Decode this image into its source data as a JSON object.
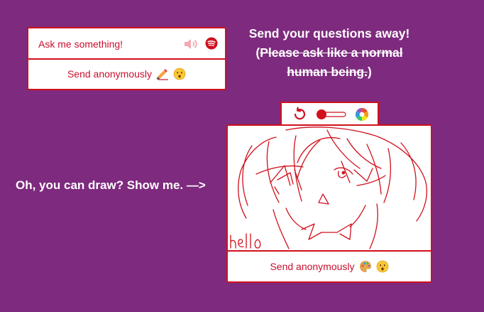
{
  "ask": {
    "placeholder": "Ask me something!",
    "send_label": "Send anonymously",
    "icons": [
      "speaker-icon",
      "spotify-icon",
      "writing-hand-emoji",
      "hushed-face-emoji"
    ]
  },
  "prompt": {
    "line1": "Send your questions away!",
    "paren_open": "(",
    "strike_text": "Please ask like a normal human being.",
    "paren_close": ")"
  },
  "draw": {
    "label": "Oh, you can draw? Show me. —>",
    "send_label": "Send anonymously",
    "canvas_text": "hello",
    "toolbar_icons": [
      "undo-icon",
      "brush-size-slider",
      "color-wheel-icon"
    ],
    "stroke_color": "#d0101c"
  },
  "colors": {
    "background": "#7e2a7e",
    "accent": "#d0101c",
    "text_accent": "#c8102e"
  }
}
